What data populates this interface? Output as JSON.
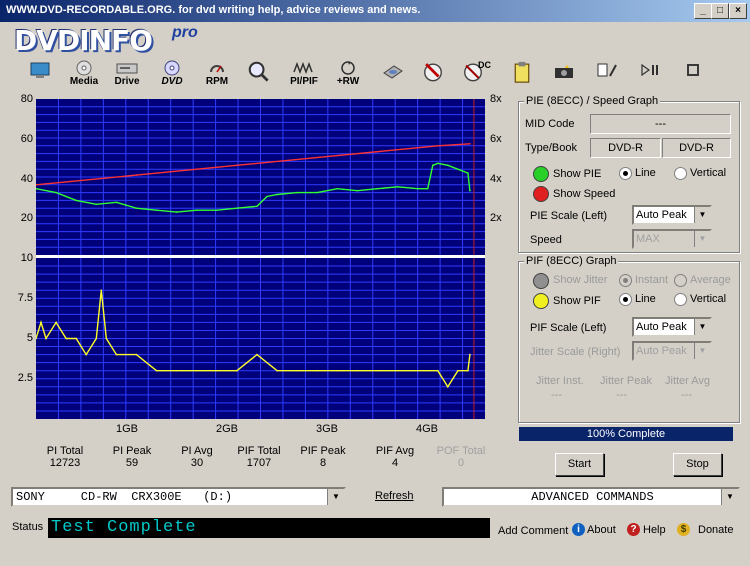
{
  "window": {
    "title": "WWW.DVD-RECORDABLE.ORG.  for dvd writing help, advice reviews and news.",
    "min_label": "_",
    "max_label": "□",
    "close_label": "×"
  },
  "logo": {
    "main": "DVDINFO",
    "suffix": "pro"
  },
  "toolbar": {
    "items": [
      {
        "name": "monitor",
        "label": ""
      },
      {
        "name": "media",
        "label": "Media"
      },
      {
        "name": "drive",
        "label": "Drive"
      },
      {
        "name": "dvd",
        "label": "DVD"
      },
      {
        "name": "rpm",
        "label": "RPM"
      },
      {
        "name": "scan",
        "label": ""
      },
      {
        "name": "pipif",
        "label": "PI/PIF"
      },
      {
        "name": "rw",
        "label": "+RW"
      },
      {
        "name": "disc-tool",
        "label": ""
      },
      {
        "name": "brush",
        "label": ""
      },
      {
        "name": "dc",
        "label": "DC"
      },
      {
        "name": "clipboard",
        "label": ""
      },
      {
        "name": "camera",
        "label": ""
      },
      {
        "name": "edit",
        "label": ""
      },
      {
        "name": "play-pause",
        "label": ""
      },
      {
        "name": "stop",
        "label": ""
      }
    ]
  },
  "graph": {
    "top_y_labels": [
      "80",
      "60",
      "40",
      "20"
    ],
    "top_y_right_labels": [
      "8x",
      "6x",
      "4x",
      "2x"
    ],
    "bottom_y_labels": [
      "10",
      "7.5",
      "5",
      "2.5"
    ],
    "x_labels": [
      "1GB",
      "2GB",
      "3GB",
      "4GB"
    ]
  },
  "chart_data": [
    {
      "type": "line",
      "title": "",
      "xlabel": "",
      "ylabel": "",
      "x_unit": "GB",
      "xlim": [
        0,
        4.47
      ],
      "ylim": [
        0,
        80
      ],
      "y2lim": [
        0,
        8
      ],
      "y2_unit": "x",
      "x_ticks": [
        "1GB",
        "2GB",
        "3GB",
        "4GB"
      ],
      "y_ticks": [
        20,
        40,
        60,
        80
      ],
      "y2_ticks": [
        "2x",
        "4x",
        "6x",
        "8x"
      ],
      "grid": true,
      "series": [
        {
          "name": "PIE",
          "color": "#32ff32",
          "x": [
            0,
            0.2,
            0.4,
            0.6,
            0.8,
            1.0,
            1.2,
            1.4,
            1.6,
            1.8,
            2.0,
            2.2,
            2.3,
            2.4,
            2.6,
            2.8,
            3.0,
            3.2,
            3.4,
            3.6,
            3.8,
            3.9,
            3.95,
            4.0,
            4.1,
            4.2,
            4.3,
            4.32
          ],
          "y": [
            34,
            32,
            28,
            26,
            27,
            24,
            23,
            22,
            23,
            23,
            24,
            25,
            30,
            31,
            32,
            32,
            34,
            33,
            34,
            35,
            34,
            34,
            46,
            47,
            46,
            44,
            42,
            33
          ]
        },
        {
          "name": "Speed",
          "color": "#ff3232",
          "x": [
            0,
            1,
            2,
            3,
            4,
            4.32
          ],
          "y": [
            3.6,
            4.1,
            4.6,
            5.1,
            5.6,
            5.7
          ]
        }
      ]
    },
    {
      "type": "line",
      "title": "",
      "xlabel": "",
      "ylabel": "",
      "x_unit": "GB",
      "xlim": [
        0,
        4.47
      ],
      "ylim": [
        0,
        10
      ],
      "y_ticks": [
        2.5,
        5,
        7.5,
        10
      ],
      "grid": true,
      "series": [
        {
          "name": "PIF",
          "color": "#ffff28",
          "x": [
            0,
            0.05,
            0.1,
            0.2,
            0.3,
            0.4,
            0.5,
            0.6,
            0.65,
            0.7,
            0.8,
            1.0,
            1.2,
            1.4,
            1.6,
            1.8,
            2.0,
            2.2,
            2.4,
            2.6,
            2.8,
            3.0,
            3.2,
            3.4,
            3.6,
            3.8,
            4.0,
            4.1,
            4.2,
            4.3,
            4.32
          ],
          "y": [
            5,
            6,
            5,
            6,
            5,
            5,
            4,
            5,
            8,
            5,
            4,
            4,
            3,
            3,
            3,
            3,
            3,
            4,
            3,
            3,
            3,
            3,
            3,
            3,
            3,
            3,
            3,
            2,
            3,
            3,
            4
          ]
        }
      ]
    }
  ],
  "stats": [
    {
      "label": "PI Total",
      "value": "12723",
      "disabled": false
    },
    {
      "label": "PI Peak",
      "value": "59",
      "disabled": false
    },
    {
      "label": "PI Avg",
      "value": "30",
      "disabled": false
    },
    {
      "label": "PIF Total",
      "value": "1707",
      "disabled": false
    },
    {
      "label": "PIF Peak",
      "value": "8",
      "disabled": false
    },
    {
      "label": "PIF Avg",
      "value": "4",
      "disabled": false
    },
    {
      "label": "POF Total",
      "value": "0",
      "disabled": true
    }
  ],
  "pie_panel": {
    "title": "PIE (8ECC) / Speed Graph",
    "mid_code_label": "MID Code",
    "mid_code_value": "---",
    "type_book_label": "Type/Book",
    "type_value": "DVD-R",
    "book_value": "DVD-R",
    "show_pie_label": "Show PIE",
    "show_speed_label": "Show Speed",
    "line_label": "Line",
    "vertical_label": "Vertical",
    "pie_scale_label": "PIE Scale (Left)",
    "pie_scale_value": "Auto Peak",
    "speed_label": "Speed",
    "speed_value": "MAX"
  },
  "pif_panel": {
    "title": "PIF (8ECC) Graph",
    "show_jitter_label": "Show Jitter",
    "instant_label": "Instant",
    "average_label": "Average",
    "show_pif_label": "Show PIF",
    "line_label": "Line",
    "vertical_label": "Vertical",
    "pif_scale_label": "PIF Scale (Left)",
    "pif_scale_value": "Auto Peak",
    "jitter_scale_label": "Jitter Scale (Right)",
    "jitter_scale_value": "Auto Peak",
    "jitter_inst_label": "Jitter Inst.",
    "jitter_inst_value": "---",
    "jitter_peak_label": "Jitter Peak",
    "jitter_peak_value": "---",
    "jitter_avg_label": "Jitter Avg",
    "jitter_avg_value": "---"
  },
  "progress": {
    "label": "100% Complete",
    "percent": 100
  },
  "buttons": {
    "start": "Start",
    "stop": "Stop",
    "refresh": "Refresh"
  },
  "drive_select": {
    "value": "SONY     CD-RW  CRX300E   (D:)"
  },
  "advanced": {
    "value": "ADVANCED COMMANDS"
  },
  "status": {
    "label": "Status",
    "text": "Test Complete"
  },
  "bottom_links": {
    "add_comment": "Add Comment",
    "about": "About",
    "help": "Help",
    "donate": "Donate"
  },
  "colors": {
    "pie": "#32ff32",
    "speed": "#ff3232",
    "pif": "#ffff28",
    "plot_bg": "#00007a",
    "grid": "#2f3cff",
    "marker": "#c81e1e"
  }
}
